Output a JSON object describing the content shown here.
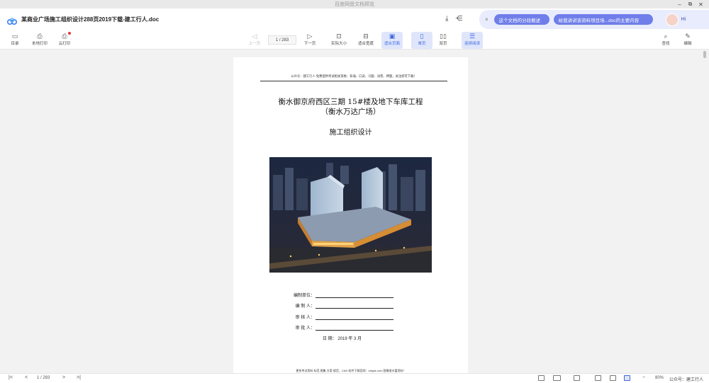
{
  "window": {
    "title": "百度网盘文档预览",
    "controls": [
      "–",
      "⧉",
      "✕"
    ]
  },
  "header": {
    "doc_title": "某商业广场施工组织设计288页2019下载-建工行人.doc",
    "download_icon": "download-icon",
    "share_icon": "share-icon"
  },
  "ai_panel": {
    "close": "×",
    "suggestion_1": "这个文档的分段概述",
    "suggestion_2": "给我讲讲该资料项目场...doc的主要内容",
    "greeting": "Hi"
  },
  "toolbar": {
    "left": [
      {
        "icon": "▭",
        "label": "目录"
      },
      {
        "icon": "⎙",
        "label": "本地打印"
      },
      {
        "icon": "⎙",
        "label": "云打印"
      }
    ],
    "prev_label": "上一页",
    "page_indicator": "1  /  283",
    "next_label": "下一页",
    "view_modes": [
      {
        "icon": "⊡",
        "label": "实际大小"
      },
      {
        "icon": "⊟",
        "label": "适合宽度"
      },
      {
        "icon": "▣",
        "label": "适合页面"
      },
      {
        "icon": "▯",
        "label": "单页"
      },
      {
        "icon": "▯▯",
        "label": "双页"
      },
      {
        "icon": "☰",
        "label": "连续阅读"
      }
    ],
    "right": [
      {
        "icon": "⌕",
        "label": "查找"
      },
      {
        "icon": "✎",
        "label": "编辑"
      }
    ]
  },
  "document": {
    "header_note": "公众号：建工行人  免费提供考试相关资格：背诵、口诀、习题、试卷、押题，关注即可下载！",
    "title_line1": "衡水御京府西区三期 15#楼及地下车库工程",
    "title_line2": "（衡水万达广场）",
    "subtitle": "施工组织设计",
    "form_labels": [
      "编制单位：",
      "编 制 人：",
      "审 核 人：",
      "审 批 人："
    ],
    "date_line": "日  期：  2019  年  3  月",
    "footer_note": "更多考试资料  标范  图集  方案  规范、CAD 软件下载官网：xdayis.com  国情很丰富资料！"
  },
  "statusbar": {
    "first": "|<",
    "prev": "<",
    "page": "1  /  283",
    "next": ">",
    "last": ">|",
    "zoom": "80%",
    "watermark": "公众号：建工行人"
  }
}
